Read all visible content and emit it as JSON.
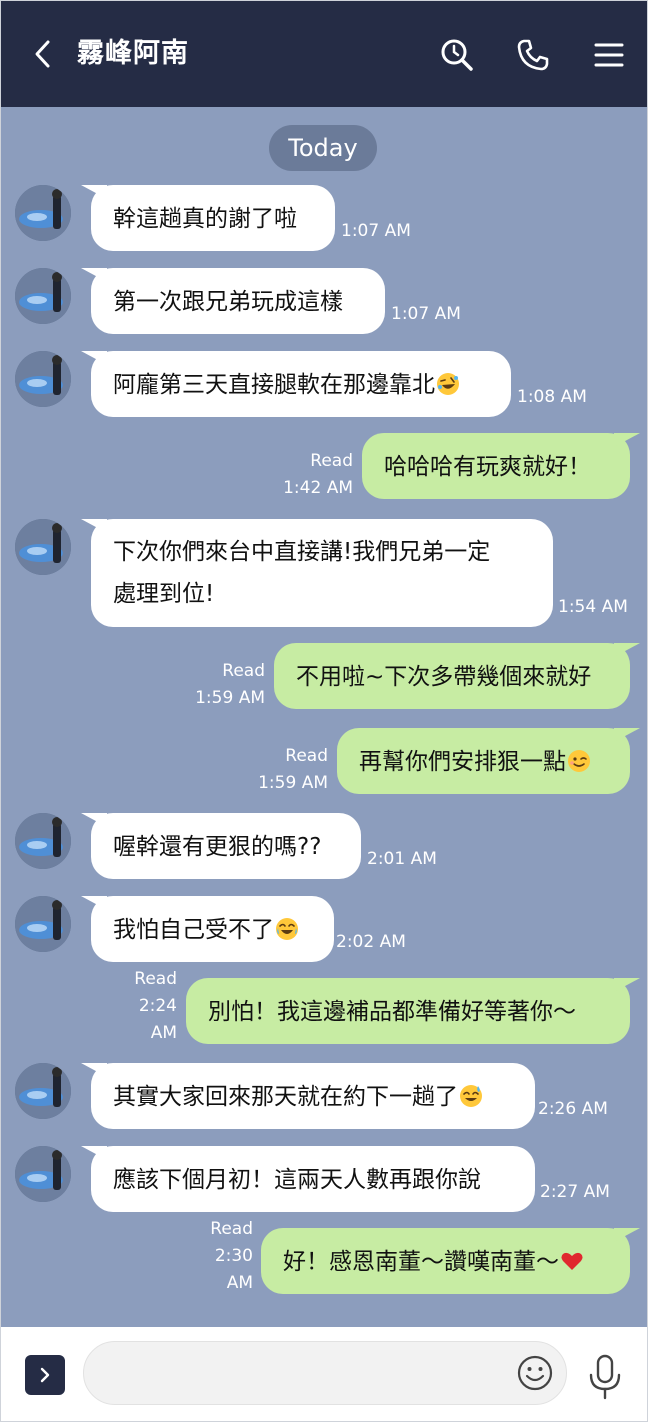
{
  "header": {
    "title": "霧峰阿南",
    "icons": [
      "back-icon",
      "search-icon",
      "phone-icon",
      "menu-icon"
    ]
  },
  "date_divider": "Today",
  "read_label": "Read",
  "colors": {
    "header": "#252c45",
    "background": "#8c9dbd",
    "incoming": "#ffffff",
    "outgoing": "#c7eca3"
  },
  "messages": [
    {
      "side": "in",
      "text": "幹這趟真的謝了啦",
      "time": "1:07 AM"
    },
    {
      "side": "in",
      "text": "第一次跟兄弟玩成這樣",
      "time": "1:07 AM"
    },
    {
      "side": "in",
      "text": "阿龐第三天直接腿軟在那邊靠北",
      "emoji": "rofl",
      "time": "1:08 AM"
    },
    {
      "side": "out",
      "text": "哈哈哈有玩爽就好！",
      "read": "Read",
      "time": "1:42 AM"
    },
    {
      "side": "in",
      "lines": [
        "下次你們來台中直接講!我們兄弟一定",
        "處理到位!"
      ],
      "time": "1:54 AM"
    },
    {
      "side": "out",
      "text": "不用啦~下次多帶幾個來就好",
      "read": "Read",
      "time": "1:59 AM"
    },
    {
      "side": "out",
      "text": "再幫你們安排狠一點",
      "emoji": "wink",
      "read": "Read",
      "time": "1:59 AM"
    },
    {
      "side": "in",
      "text": "喔幹還有更狠的嗎??",
      "time": "2:01 AM"
    },
    {
      "side": "in",
      "text": "我怕自己受不了",
      "emoji": "joy",
      "time": "2:02 AM"
    },
    {
      "side": "out",
      "text": "別怕！我這邊補品都準備好等著你～",
      "read": "Read",
      "time_lines": [
        "2:24",
        "AM"
      ]
    },
    {
      "side": "in",
      "text": "其實大家回來那天就在約下一趟了",
      "emoji": "sweat-smile",
      "time": "2:26 AM"
    },
    {
      "side": "in",
      "text": "應該下個月初！這兩天人數再跟你說",
      "time": "2:27 AM"
    },
    {
      "side": "out",
      "text": "好！感恩南董～讚嘆南董～",
      "emoji": "heart",
      "read": "Read",
      "time_lines": [
        "2:30",
        "AM"
      ]
    }
  ],
  "input_bar": {
    "placeholder": "",
    "icons": [
      "expand-icon",
      "smiley-icon",
      "mic-icon"
    ]
  }
}
